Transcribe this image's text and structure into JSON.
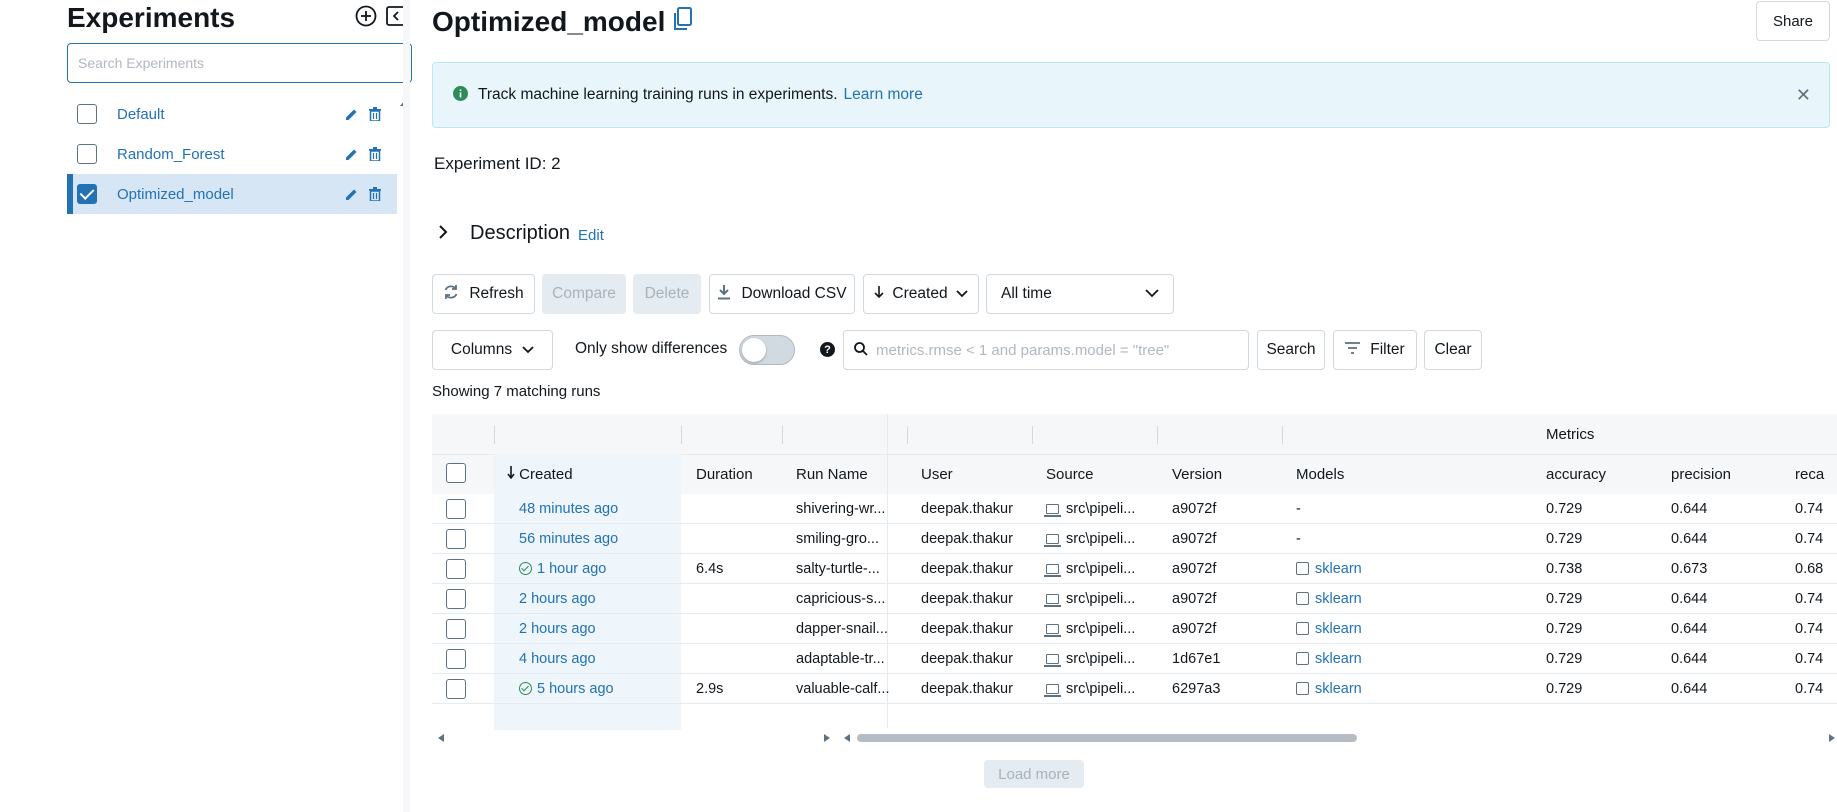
{
  "sidebar": {
    "title": "Experiments",
    "search_placeholder": "Search Experiments",
    "experiments": [
      {
        "name": "Default",
        "checked": false
      },
      {
        "name": "Random_Forest",
        "checked": false
      },
      {
        "name": "Optimized_model",
        "checked": true
      }
    ]
  },
  "header": {
    "title": "Optimized_model",
    "share_label": "Share"
  },
  "banner": {
    "text": "Track machine learning training runs in experiments.",
    "link": "Learn more",
    "close": "✕"
  },
  "experiment_id": "Experiment ID:  2",
  "description": {
    "label": "Description",
    "edit": "Edit"
  },
  "toolbar": {
    "refresh": "Refresh",
    "compare": "Compare",
    "delete": "Delete",
    "download_csv": "Download CSV",
    "sort": "Created",
    "time_range": "All time",
    "columns": "Columns",
    "only_differences": "Only show differences",
    "search_placeholder": "metrics.rmse < 1 and params.model = \"tree\"",
    "search_button": "Search",
    "filter": "Filter",
    "clear": "Clear"
  },
  "showing": "Showing 7 matching runs",
  "table": {
    "group_header": "Metrics",
    "columns": [
      "Created",
      "Duration",
      "Run Name",
      "User",
      "Source",
      "Version",
      "Models",
      "accuracy",
      "precision",
      "reca"
    ],
    "rows": [
      {
        "created": "48 minutes ago",
        "ok": false,
        "duration": "",
        "run_name": "shivering-wr...",
        "user": "deepak.thakur",
        "source": "src\\pipeli...",
        "version": "a9072f",
        "models": "-",
        "has_model": false,
        "accuracy": "0.729",
        "precision": "0.644",
        "recall": "0.74"
      },
      {
        "created": "56 minutes ago",
        "ok": false,
        "duration": "",
        "run_name": "smiling-gro...",
        "user": "deepak.thakur",
        "source": "src\\pipeli...",
        "version": "a9072f",
        "models": "-",
        "has_model": false,
        "accuracy": "0.729",
        "precision": "0.644",
        "recall": "0.74"
      },
      {
        "created": "1 hour ago",
        "ok": true,
        "duration": "6.4s",
        "run_name": "salty-turtle-...",
        "user": "deepak.thakur",
        "source": "src\\pipeli...",
        "version": "a9072f",
        "models": "sklearn",
        "has_model": true,
        "accuracy": "0.738",
        "precision": "0.673",
        "recall": "0.68"
      },
      {
        "created": "2 hours ago",
        "ok": false,
        "duration": "",
        "run_name": "capricious-s...",
        "user": "deepak.thakur",
        "source": "src\\pipeli...",
        "version": "a9072f",
        "models": "sklearn",
        "has_model": true,
        "accuracy": "0.729",
        "precision": "0.644",
        "recall": "0.74"
      },
      {
        "created": "2 hours ago",
        "ok": false,
        "duration": "",
        "run_name": "dapper-snail...",
        "user": "deepak.thakur",
        "source": "src\\pipeli...",
        "version": "a9072f",
        "models": "sklearn",
        "has_model": true,
        "accuracy": "0.729",
        "precision": "0.644",
        "recall": "0.74"
      },
      {
        "created": "4 hours ago",
        "ok": false,
        "duration": "",
        "run_name": "adaptable-tr...",
        "user": "deepak.thakur",
        "source": "src\\pipeli...",
        "version": "1d67e1",
        "models": "sklearn",
        "has_model": true,
        "accuracy": "0.729",
        "precision": "0.644",
        "recall": "0.74"
      },
      {
        "created": "5 hours ago",
        "ok": true,
        "duration": "2.9s",
        "run_name": "valuable-calf...",
        "user": "deepak.thakur",
        "source": "src\\pipeli...",
        "version": "6297a3",
        "models": "sklearn",
        "has_model": true,
        "accuracy": "0.729",
        "precision": "0.644",
        "recall": "0.74"
      }
    ]
  },
  "load_more": "Load more",
  "colors": {
    "accent": "#2272b4",
    "success": "#2e8a58",
    "banner_bg": "#e8f6fb"
  }
}
